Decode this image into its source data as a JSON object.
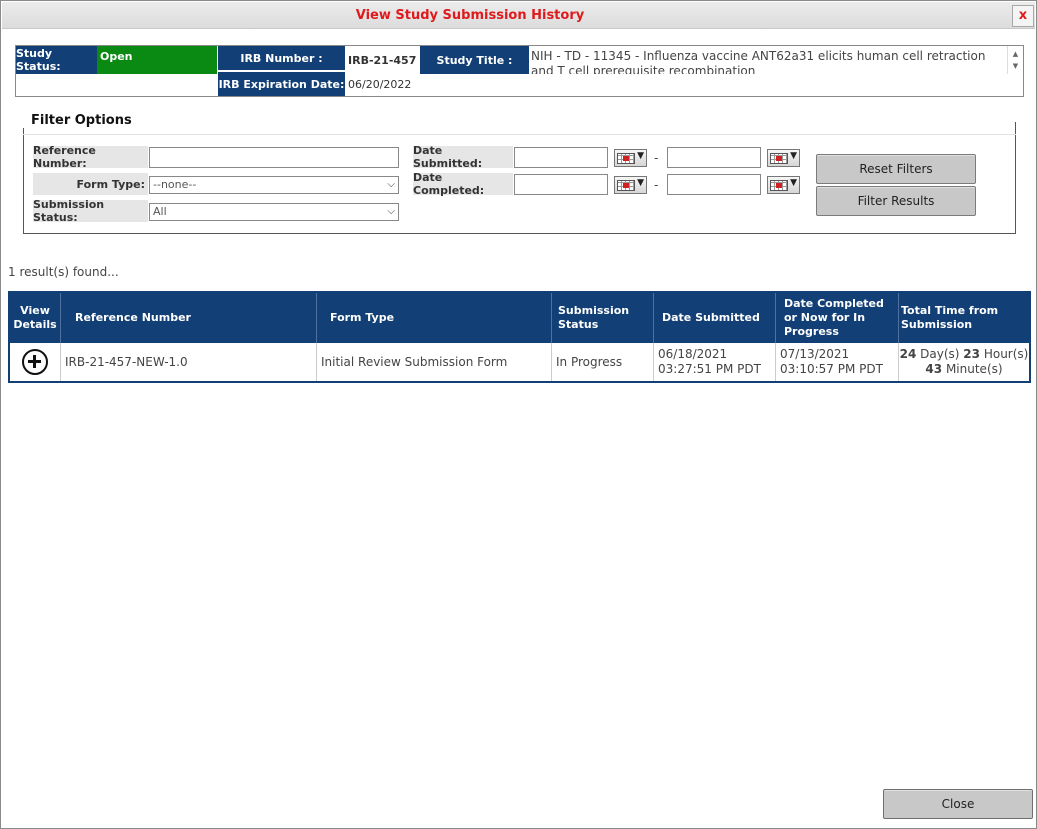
{
  "dialog": {
    "title": "View Study Submission History",
    "close_x": "x",
    "close_button": "Close"
  },
  "study": {
    "status_label": "Study Status:",
    "status_value": "Open",
    "irb_label": "IRB Number :",
    "irb_value": "IRB-21-457",
    "title_label": "Study Title :",
    "title_value": "NIH - TD - 11345 - Influenza vaccine ANT62a31 elicits human cell retraction and T cell prerequisite recombination",
    "expiration_label": "IRB Expiration Date:",
    "expiration_value": "06/20/2022"
  },
  "filter": {
    "heading": "Filter Options",
    "reference_label": "Reference Number:",
    "reference_value": "",
    "form_type_label": "Form Type:",
    "form_type_value": "--none--",
    "submission_status_label": "Submission Status:",
    "submission_status_value": "All",
    "date_submitted_label": "Date Submitted:",
    "date_completed_label": "Date Completed:",
    "dash": "-",
    "reset_button": "Reset Filters",
    "filter_button": "Filter Results"
  },
  "results": {
    "count_text": "1 result(s) found...",
    "columns": [
      "View Details",
      "Reference Number",
      "Form Type",
      "Submission Status",
      "Date Submitted",
      "Date Completed or Now for In Progress",
      "Total Time from Submission"
    ],
    "rows": [
      {
        "reference": "IRB-21-457-NEW-1.0",
        "form_type": "Initial Review Submission Form",
        "status": "In Progress",
        "submitted_date": "06/18/2021",
        "submitted_time": "03:27:51 PM PDT",
        "completed_date": "07/13/2021",
        "completed_time": "03:10:57 PM PDT",
        "days": "24",
        "days_unit": "Day(s)",
        "hours": "23",
        "hours_unit": "Hour(s)",
        "minutes": "43",
        "minutes_unit": "Minute(s)"
      }
    ]
  }
}
